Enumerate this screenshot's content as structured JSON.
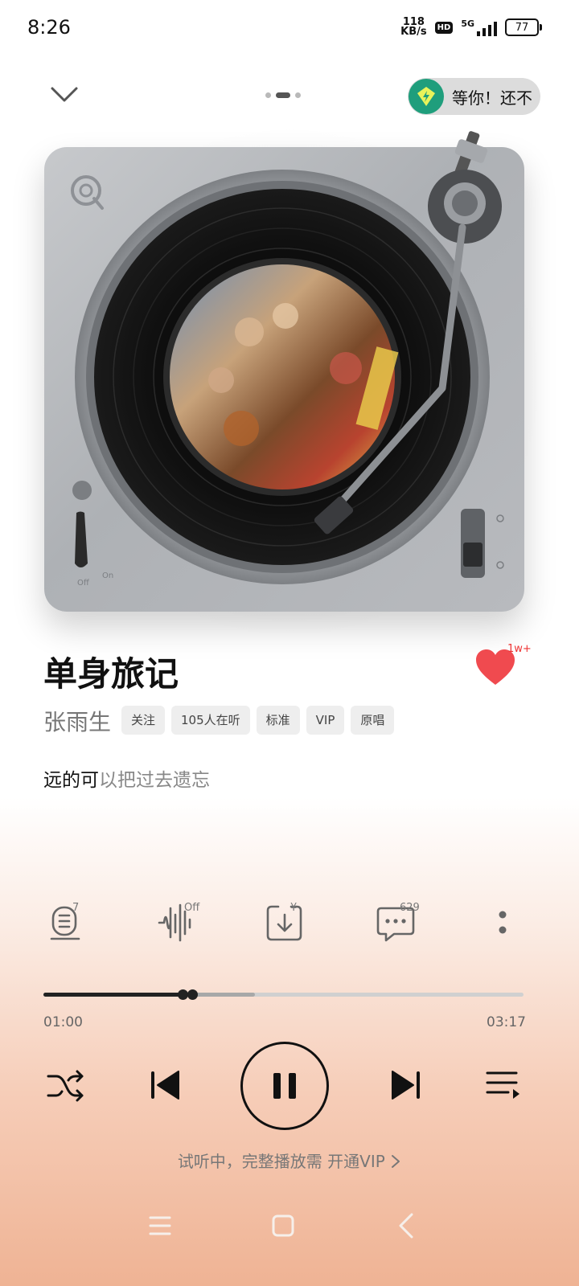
{
  "status_bar": {
    "time": "8:26",
    "net_speed_value": "118",
    "net_speed_unit": "KB/s",
    "hd": "HD",
    "network": "5G",
    "battery": "77"
  },
  "header": {
    "page_count": 3,
    "active_page": 2,
    "promo_text": "等你！还不"
  },
  "song": {
    "title": "单身旅记",
    "artist": "张雨生",
    "likes": "1w+",
    "liked": true,
    "tags": [
      "关注",
      "105人在听",
      "标准",
      "VIP",
      "原唱"
    ]
  },
  "lyric": {
    "sung": "远的可",
    "unsung": "以把过去遗忘"
  },
  "actions": {
    "lyrics_badge": "7",
    "effect_badge": "Off",
    "download_badge": "¥",
    "comments_badge": "629"
  },
  "playback": {
    "current": "01:00",
    "total": "03:17",
    "progress": 0.31,
    "buffered": 0.44,
    "playing": true
  },
  "footer": {
    "trial_text": "试听中，完整播放需",
    "vip_link": "开通VIP"
  },
  "turntable": {
    "switch_left_off": "Off",
    "switch_left_on": "On"
  },
  "colors": {
    "heart": "#f04a4f",
    "promo_icon_bg": "#1f9e7c",
    "gradient_bottom": "#efb394"
  }
}
